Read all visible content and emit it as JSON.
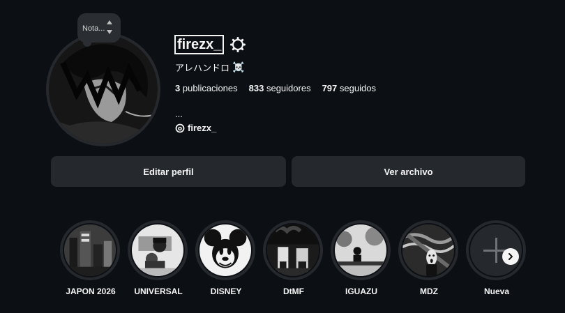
{
  "profile": {
    "username": "firezx_",
    "full_name": "アレハンドロ",
    "full_name_emoji": "☠️",
    "note_label": "Nota...",
    "stats": {
      "posts_count": "3",
      "posts_label": "publicaciones",
      "followers_count": "833",
      "followers_label": "seguidores",
      "following_count": "797",
      "following_label": "seguidos"
    },
    "bio": "...",
    "threads_handle": "firezx_"
  },
  "buttons": {
    "edit_profile": "Editar perfil",
    "view_archive": "Ver archivo"
  },
  "highlights": [
    {
      "label": "JAPON 2026"
    },
    {
      "label": "UNIVERSAL"
    },
    {
      "label": "DISNEY"
    },
    {
      "label": "DtMF"
    },
    {
      "label": "IGUAZU"
    },
    {
      "label": "MDZ"
    },
    {
      "label": "Nueva"
    }
  ],
  "icons": {
    "settings": "gear-icon",
    "threads": "threads-icon",
    "next": "chevron-right-icon",
    "add": "plus-icon"
  },
  "colors": {
    "background": "#0c1014",
    "button": "#25292e",
    "text": "#f5f5f5"
  }
}
